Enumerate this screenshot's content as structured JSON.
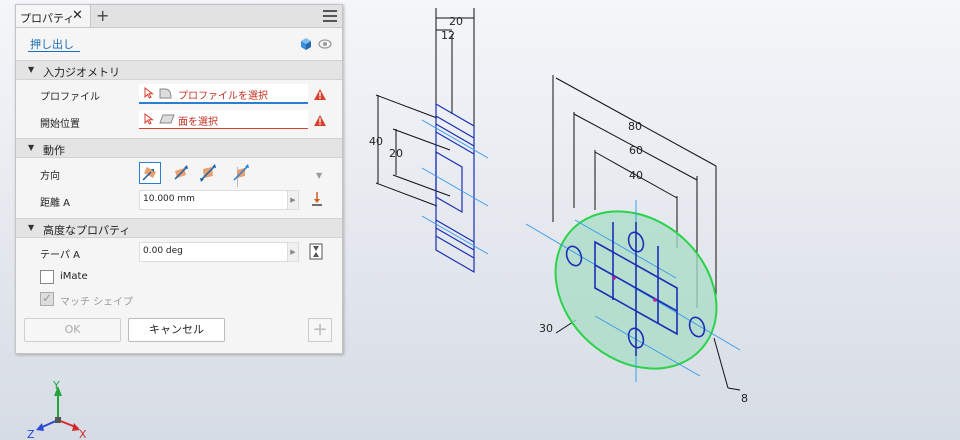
{
  "panel": {
    "tab_label": "プロパティ",
    "tab_close": "✕",
    "tab_add": "+",
    "command_name": "押し出し"
  },
  "sections": {
    "input_geometry": "入力ジオメトリ",
    "behavior": "動作",
    "advanced": "高度なプロパティ"
  },
  "input_geometry": {
    "profile_label": "プロファイル",
    "profile_prompt": "プロファイルを選択",
    "start_label": "開始位置",
    "start_prompt": "面を選択"
  },
  "behavior": {
    "direction_label": "方向",
    "distance_label": "距離 A",
    "distance_value": "10.000 mm"
  },
  "advanced": {
    "taper_label": "テーパ A",
    "taper_value": "0.00 deg",
    "imate_label": "iMate",
    "match_shape_label": "マッチ シェイプ"
  },
  "buttons": {
    "ok": "OK",
    "cancel": "キャンセル"
  },
  "viewport": {
    "dims_left": [
      "20",
      "12",
      "40",
      "20"
    ],
    "dims_right": [
      "80",
      "60",
      "40",
      "30",
      "8"
    ],
    "axes": [
      "Y",
      "Z",
      "X"
    ]
  },
  "colors": {
    "accent": "#2a7fd4",
    "error": "#d9412f",
    "sketch_blue": "#1a2fb4",
    "profile_fill": "#a8dcc6",
    "profile_stroke": "#2bd24a"
  }
}
